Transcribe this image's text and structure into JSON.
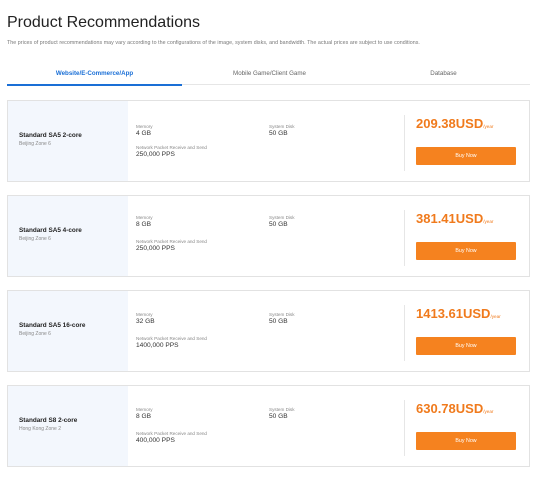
{
  "page": {
    "title": "Product Recommendations",
    "subtitle": "The prices of product recommendations may vary according to the configurations of the image, system disks, and bandwidth. The actual prices are subject to use conditions."
  },
  "tabs": [
    {
      "label": "Website/E-Commerce/App",
      "active": true
    },
    {
      "label": "Mobile Game/Client Game",
      "active": false
    },
    {
      "label": "Database",
      "active": false
    }
  ],
  "labels": {
    "memory": "Memory",
    "system_disk": "System Disk",
    "network": "Network Packet Receive and Send",
    "per_year": "/year",
    "buy_now": "Buy Now"
  },
  "products": [
    {
      "name": "Standard SA5 2-core",
      "region": "Beijing Zone 6",
      "memory": "4 GB",
      "disk": "50 GB",
      "pps": "250,000 PPS",
      "price": "209.38USD"
    },
    {
      "name": "Standard SA5 4-core",
      "region": "Beijing Zone 6",
      "memory": "8 GB",
      "disk": "50 GB",
      "pps": "250,000 PPS",
      "price": "381.41USD"
    },
    {
      "name": "Standard SA5 16-core",
      "region": "Beijing Zone 6",
      "memory": "32 GB",
      "disk": "50 GB",
      "pps": "1400,000 PPS",
      "price": "1413.61USD"
    },
    {
      "name": "Standard S8 2-core",
      "region": "Hong Kong Zone 2",
      "memory": "8 GB",
      "disk": "50 GB",
      "pps": "400,000 PPS",
      "price": "630.78USD"
    }
  ],
  "colors": {
    "accent": "#1a6fd6",
    "price": "#f07a1c",
    "button": "#f5821f",
    "card_left_bg": "#f3f7fd"
  }
}
